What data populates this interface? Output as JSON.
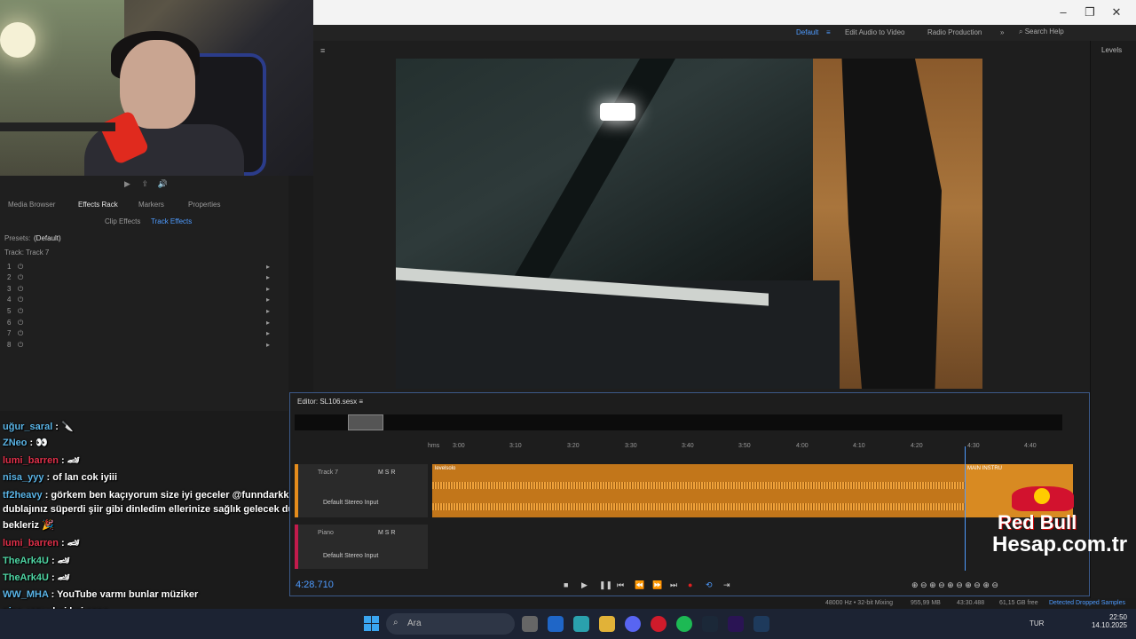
{
  "window": {
    "minimize": "–",
    "maximize": "❐",
    "close": "✕"
  },
  "workspaces": {
    "default": "Default",
    "edit_audio_video": "Edit Audio to Video",
    "radio": "Radio Production",
    "search": "Search Help"
  },
  "levels_label": "Levels",
  "left_tabs": {
    "media_browser": "Media Browser",
    "effects_rack": "Effects Rack",
    "markers": "Markers",
    "properties": "Properties"
  },
  "subtabs": {
    "clip": "Clip Effects",
    "track": "Track Effects"
  },
  "presets": {
    "label": "Presets:",
    "value": "(Default)"
  },
  "track_label": "Track: Track 7",
  "rack_slots": [
    "1",
    "2",
    "3",
    "4",
    "5",
    "6",
    "7",
    "8"
  ],
  "chat": [
    {
      "user": "uğur_saral",
      "text": " : 🔪",
      "color": "blue"
    },
    {
      "user": "ZNeo",
      "text": " : 👀",
      "color": "blue"
    },
    {
      "user": "lumi_barren",
      "text": " : 🏎",
      "color": "red"
    },
    {
      "user": "nisa_yyy",
      "text": " : of lan cok iyiii",
      "color": "blue"
    },
    {
      "user": "tf2heavy",
      "text": " : görkem ben kaçıyorum size iyi geceler @funndarkk,abi",
      "color": "blue"
    },
    {
      "user": "",
      "text": "dublajınız süperdi şiir gibi dinledim ellerinize sağlık gelecek dublajlarınızı",
      "color": ""
    },
    {
      "user": "",
      "text": "bekleriz 🎉",
      "color": ""
    },
    {
      "user": "lumi_barren",
      "text": " : 🏎",
      "color": "red"
    },
    {
      "user": "TheArk4U",
      "text": " : 🏎",
      "color": "green"
    },
    {
      "user": "TheArk4U",
      "text": " : 🏎",
      "color": "green"
    },
    {
      "user": "WW_MHA",
      "text": " : YouTube varmı bunlar müziker",
      "color": "blue"
    },
    {
      "user": "nisa_yyy",
      "text": " : bai bai cano",
      "color": "blue"
    }
  ],
  "editor": {
    "title": "Editor: SL106.sesx",
    "ruler": [
      "hms",
      "3:00",
      "3:10",
      "3:20",
      "3:30",
      "3:40",
      "3:50",
      "4:00",
      "4:10",
      "4:20",
      "4:30",
      "4:40"
    ],
    "track7_name": "Track 7",
    "track7_input": "Default Stereo Input",
    "piano_name": "Piano",
    "piano_input": "Default Stereo Input",
    "clip1_label": "levelsolo",
    "clip2_label": "MAIN INSTRU",
    "timecode": "4:28.710"
  },
  "branding": {
    "redbull": "Red Bull",
    "hesap": "Hesap.com.tr"
  },
  "status": {
    "rate": "48000 Hz • 32-bit Mixing",
    "mem": "955,99 MB",
    "dur": "43:30.488",
    "free": "61,15 GB free",
    "dropped": "Detected Dropped Samples"
  },
  "taskbar": {
    "search": "Ara",
    "lang": "TUR",
    "time": "22:50",
    "date": "14.10.2025"
  }
}
